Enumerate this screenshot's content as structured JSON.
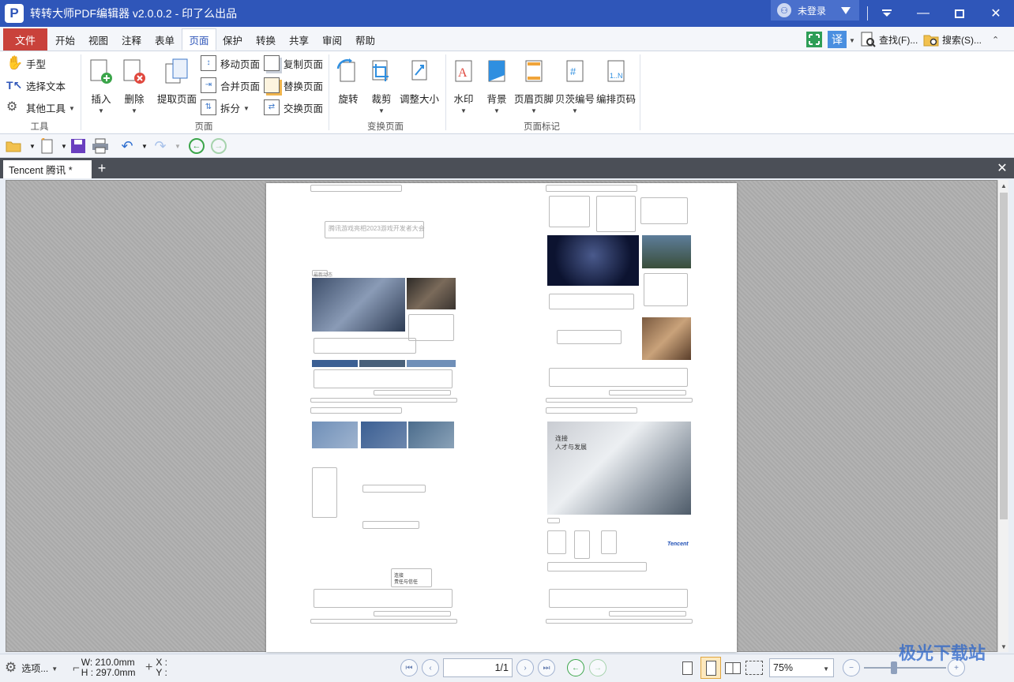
{
  "app": {
    "title": "转转大师PDF编辑器 v2.0.0.2 - 印了么出品",
    "login": "未登录",
    "logo": "P"
  },
  "menu": {
    "file": "文件",
    "items": [
      "开始",
      "视图",
      "注释",
      "表单",
      "页面",
      "保护",
      "转换",
      "共享",
      "审阅",
      "帮助"
    ],
    "active": "页面",
    "find": "查找(F)...",
    "search": "搜索(S)..."
  },
  "ribbon": {
    "tools": {
      "hand": "手型",
      "select_text": "选择文本",
      "other": "其他工具",
      "group": "工具"
    },
    "page": {
      "insert": "插入",
      "delete": "删除",
      "extract": "提取页面",
      "move": "移动页面",
      "merge": "合并页面",
      "split": "拆分",
      "copy": "复制页面",
      "replace": "替换页面",
      "swap": "交换页面",
      "group": "页面"
    },
    "transform": {
      "rotate": "旋转",
      "crop": "裁剪",
      "resize": "调整大小",
      "group": "变换页面"
    },
    "marks": {
      "watermark": "水印",
      "background": "背景",
      "header_footer": "页眉页脚",
      "bates": "贝茨编号",
      "numbering": "编排页码",
      "group": "页面标记"
    }
  },
  "tabs": {
    "doc": "Tencent 腾讯 *",
    "add": "+",
    "close": "✕"
  },
  "document": {
    "page1_title": "腾讯游戏亮相2023游戏开发者大会",
    "news_label": "最新动态",
    "career_line1": "连接",
    "career_line2": "人才与发展",
    "brand": "Tencent",
    "culture": "连接",
    "culture2": "责任与信任"
  },
  "status": {
    "options": "选项...",
    "width": "W: 210.0mm",
    "height": "H : 297.0mm",
    "x": "X :",
    "y": "Y :",
    "page": "1/1",
    "zoom": "75%"
  },
  "watermark_text": "极光下载站",
  "colors": {
    "titlebar": "#2f56b9",
    "file_menu": "#c9423b",
    "accent": "#2f56b9"
  }
}
